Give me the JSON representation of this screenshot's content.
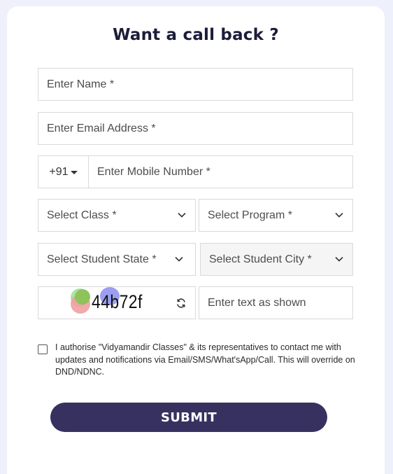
{
  "form": {
    "title": "Want a call back ?",
    "name_placeholder": "Enter Name *",
    "email_placeholder": "Enter Email Address *",
    "country_code": "+91",
    "mobile_placeholder": "Enter Mobile Number *",
    "class_label": "Select Class *",
    "program_label": "Select Program *",
    "state_label": "Select Student State *",
    "city_label": "Select Student City *",
    "captcha_text": "44b72f",
    "captcha_input_placeholder": "Enter text as shown",
    "consent_text": "I authorise \"Vidyamandir Classes\" & its representatives to contact me with updates and notifications via Email/SMS/What'sApp/Call. This will override on DND/NDNC.",
    "submit_label": "SUBMIT"
  },
  "colors": {
    "background": "#eef1fb",
    "card": "#ffffff",
    "title": "#1c1c3a",
    "submit_bg": "#373160",
    "border": "#d9d9de"
  }
}
